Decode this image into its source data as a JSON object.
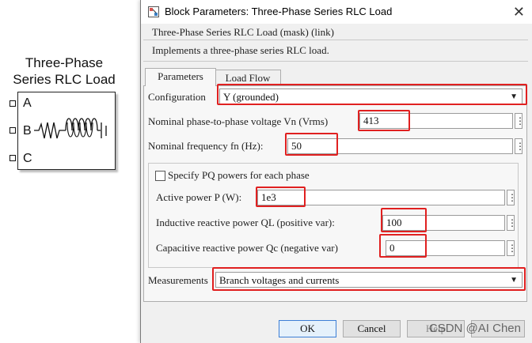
{
  "block": {
    "title_line1": "Three-Phase",
    "title_line2": "Series RLC Load",
    "ports": [
      "A",
      "B",
      "C"
    ]
  },
  "dialog": {
    "title": "Block Parameters: Three-Phase Series RLC Load",
    "header": "Three-Phase Series RLC Load (mask) (link)",
    "description": "Implements a three-phase series RLC load.",
    "tabs": [
      {
        "label": "Parameters",
        "active": true
      },
      {
        "label": "Load Flow",
        "active": false
      }
    ],
    "configuration": {
      "label": "Configuration",
      "value": "Y (grounded)"
    },
    "nominal_voltage": {
      "label": "Nominal phase-to-phase voltage Vn (Vrms)",
      "value": "413"
    },
    "nominal_frequency": {
      "label": "Nominal frequency fn (Hz):",
      "value": "50"
    },
    "specify_pq": {
      "label": "Specify PQ powers for each phase",
      "checked": false
    },
    "active_power": {
      "label": "Active power P (W):",
      "value": "1e3"
    },
    "inductive_power": {
      "label": "Inductive reactive power QL (positive var):",
      "value": "100"
    },
    "capacitive_power": {
      "label": "Capacitive reactive power Qc (negative var)",
      "value": "0"
    },
    "measurements": {
      "label": "Measurements",
      "value": "Branch voltages and currents"
    },
    "buttons": {
      "ok": "OK",
      "cancel": "Cancel",
      "help": "Help"
    }
  },
  "watermark": "CSDN @AI Chen",
  "colors": {
    "highlight": "#e02020",
    "window_bg": "#f0f0f0"
  }
}
